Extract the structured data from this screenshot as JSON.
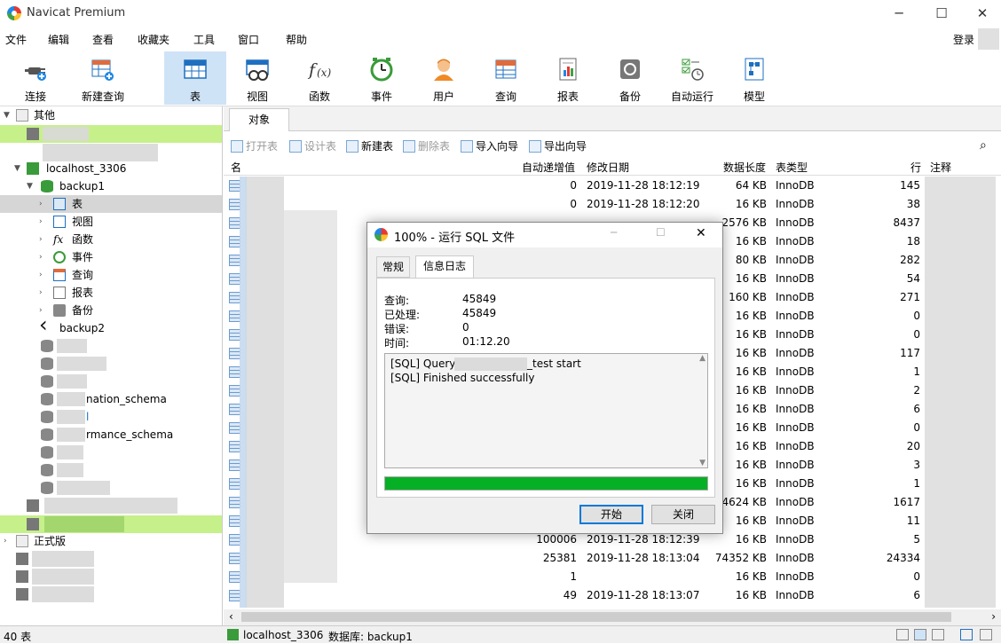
{
  "window": {
    "title": "Navicat Premium",
    "min": "─",
    "max": "☐",
    "close": "✕"
  },
  "menu": {
    "items": [
      "文件",
      "编辑",
      "查看",
      "收藏夹",
      "工具",
      "窗口",
      "帮助"
    ],
    "login": "登录"
  },
  "toolbar": {
    "connect": "连接",
    "new_query": "新建查询",
    "table": "表",
    "view": "视图",
    "function": "函数",
    "event": "事件",
    "user": "用户",
    "query": "查询",
    "report": "报表",
    "backup": "备份",
    "automation": "自动运行",
    "model": "模型"
  },
  "sidebar": {
    "group_other": "其他",
    "connection": "localhost_3306",
    "db_backup1": "backup1",
    "items": [
      "表",
      "视图",
      "函数",
      "事件",
      "查询",
      "报表",
      "备份"
    ],
    "db_backup2": "backup2",
    "db_info_schema": "nation_schema",
    "db_l": "l",
    "db_perf_schema": "rmance_schema",
    "group_main": "正式版"
  },
  "main": {
    "tab_objects": "对象",
    "actions": {
      "open": "打开表",
      "design": "设计表",
      "new": "新建表",
      "delete": "删除表",
      "import": "导入向导",
      "export": "导出向导"
    },
    "columns": {
      "name": "名",
      "auto_inc": "自动递增值",
      "modified": "修改日期",
      "data_len": "数据长度",
      "engine": "表类型",
      "rows": "行",
      "comment": "注释"
    },
    "rows": [
      {
        "auto": "0",
        "date": "2019-11-28 18:12:19",
        "len": "64 KB",
        "eng": "InnoDB",
        "rows": "145"
      },
      {
        "auto": "0",
        "date": "2019-11-28 18:12:20",
        "len": "16 KB",
        "eng": "InnoDB",
        "rows": "38"
      },
      {
        "auto": "",
        "date": "",
        "len": "2576 KB",
        "eng": "InnoDB",
        "rows": "8437"
      },
      {
        "auto": "",
        "date": "",
        "len": "16 KB",
        "eng": "InnoDB",
        "rows": "18"
      },
      {
        "auto": "",
        "date": "",
        "len": "80 KB",
        "eng": "InnoDB",
        "rows": "282"
      },
      {
        "auto": "",
        "date": "",
        "len": "16 KB",
        "eng": "InnoDB",
        "rows": "54"
      },
      {
        "auto": "",
        "date": "",
        "len": "160 KB",
        "eng": "InnoDB",
        "rows": "271"
      },
      {
        "auto": "",
        "date": "",
        "len": "16 KB",
        "eng": "InnoDB",
        "rows": "0"
      },
      {
        "auto": "",
        "date": "",
        "len": "16 KB",
        "eng": "InnoDB",
        "rows": "0"
      },
      {
        "auto": "",
        "date": "",
        "len": "16 KB",
        "eng": "InnoDB",
        "rows": "117"
      },
      {
        "auto": "",
        "date": "",
        "len": "16 KB",
        "eng": "InnoDB",
        "rows": "1"
      },
      {
        "auto": "",
        "date": "",
        "len": "16 KB",
        "eng": "InnoDB",
        "rows": "2"
      },
      {
        "auto": "",
        "date": "",
        "len": "16 KB",
        "eng": "InnoDB",
        "rows": "6"
      },
      {
        "auto": "",
        "date": "",
        "len": "16 KB",
        "eng": "InnoDB",
        "rows": "0"
      },
      {
        "auto": "",
        "date": "",
        "len": "16 KB",
        "eng": "InnoDB",
        "rows": "20"
      },
      {
        "auto": "",
        "date": "",
        "len": "16 KB",
        "eng": "InnoDB",
        "rows": "3"
      },
      {
        "auto": "",
        "date": "",
        "len": "16 KB",
        "eng": "InnoDB",
        "rows": "1"
      },
      {
        "auto": "",
        "date": "",
        "len": "4624 KB",
        "eng": "InnoDB",
        "rows": "1617"
      },
      {
        "auto": "",
        "date": "",
        "len": "16 KB",
        "eng": "InnoDB",
        "rows": "11"
      },
      {
        "auto": "100006",
        "date": "2019-11-28 18:12:39",
        "len": "16 KB",
        "eng": "InnoDB",
        "rows": "5"
      },
      {
        "auto": "25381",
        "date": "2019-11-28 18:13:04",
        "len": "74352 KB",
        "eng": "InnoDB",
        "rows": "24334"
      },
      {
        "auto": "1",
        "date": "",
        "len": "16 KB",
        "eng": "InnoDB",
        "rows": "0"
      },
      {
        "auto": "49",
        "date": "2019-11-28 18:13:07",
        "len": "16 KB",
        "eng": "InnoDB",
        "rows": "6"
      }
    ]
  },
  "dialog": {
    "title": "100% - 运行 SQL 文件",
    "tab_general": "常规",
    "tab_log": "信息日志",
    "labels": {
      "queries": "查询:",
      "processed": "已处理:",
      "errors": "错误:",
      "time": "时间:"
    },
    "values": {
      "queries": "45849",
      "processed": "45849",
      "errors": "0",
      "time": "01:12.20"
    },
    "log": [
      "[SQL] Query",
      "_test start",
      "[SQL] Finished successfully"
    ],
    "progress": 100,
    "start": "开始",
    "close": "关闭"
  },
  "status": {
    "count": "40 表",
    "connection": "localhost_3306",
    "database": "数据库: backup1"
  },
  "colors": {
    "accent": "#cfe3f7",
    "highlight": "#c6f08a",
    "progress": "#06b025"
  }
}
